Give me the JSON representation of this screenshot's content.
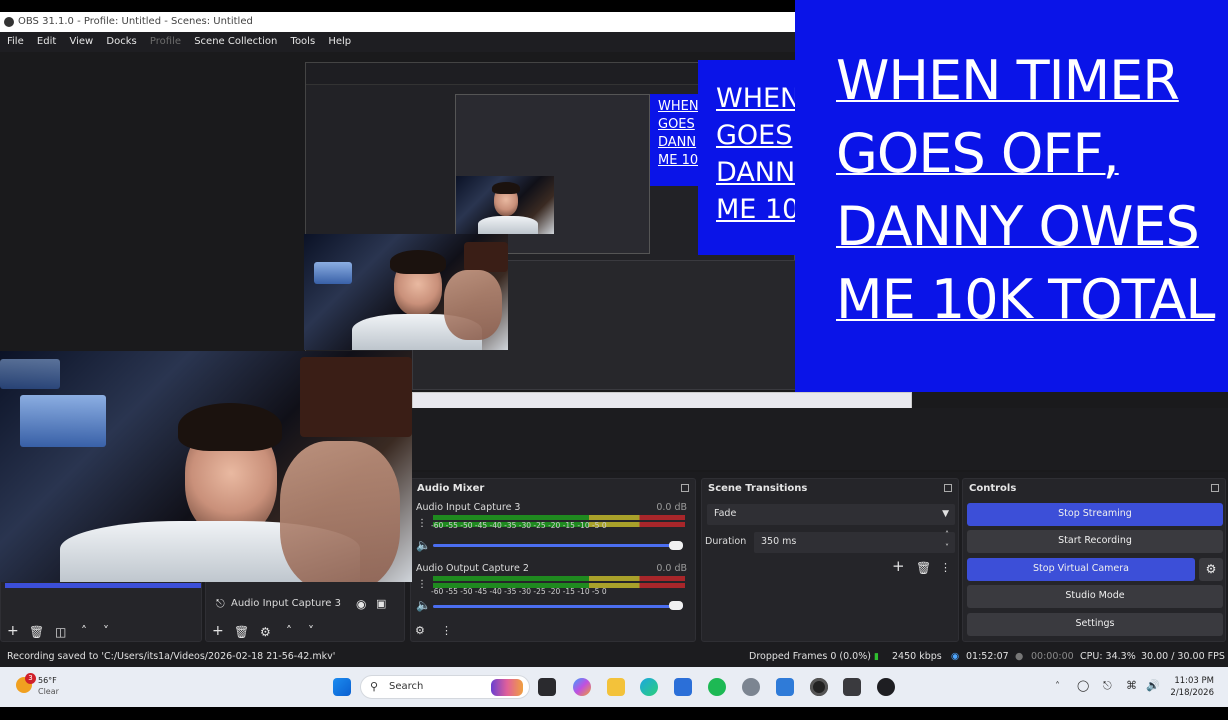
{
  "window": {
    "title": "OBS 31.1.0 - Profile: Untitled - Scenes: Untitled"
  },
  "menu": [
    "File",
    "Edit",
    "View",
    "Docks",
    "Profile",
    "Scene Collection",
    "Tools",
    "Help"
  ],
  "overlay": {
    "lines": [
      "WHEN TIMER",
      "GOES OFF,",
      "DANNY OWES",
      "ME 10K TOTAL"
    ],
    "nested_lines": [
      "WHEN",
      "GOES",
      "DANN",
      "ME 10"
    ],
    "nested_small_lines": [
      "WHEN",
      "GOES",
      "DANN",
      "ME 10"
    ],
    "bg_color": "#0a14e8"
  },
  "sources": {
    "item_label": "Audio Input Capture 3"
  },
  "audio_mixer": {
    "title": "Audio Mixer",
    "channels": [
      {
        "name": "Audio Input Capture 3",
        "db": "0.0 dB",
        "ticks": "-60  -55  -50  -45  -40  -35  -30  -25  -20  -15  -10   -5    0"
      },
      {
        "name": "Audio Output Capture 2",
        "db": "0.0 dB",
        "ticks": "-60  -55  -50  -45  -40  -35  -30  -25  -20  -15  -10   -5    0"
      }
    ]
  },
  "scene_transitions": {
    "title": "Scene Transitions",
    "transition": "Fade",
    "duration_label": "Duration",
    "duration_value": "350 ms"
  },
  "controls": {
    "title": "Controls",
    "stop_streaming": "Stop Streaming",
    "start_recording": "Start Recording",
    "stop_virtual_camera": "Stop Virtual Camera",
    "studio_mode": "Studio Mode",
    "settings": "Settings",
    "accent": "#3c4fd8"
  },
  "statusbar": {
    "message": "Recording saved to 'C:/Users/its1a/Videos/2026-02-18 21-56-42.mkv'",
    "dropped_frames": "Dropped Frames 0 (0.0%)",
    "bitrate": "2450 kbps",
    "stream_time": "01:52:07",
    "record_time": "00:00:00",
    "cpu": "CPU: 34.3%",
    "fps": "30.00 / 30.00 FPS"
  },
  "taskbar": {
    "weather_temp": "56°F",
    "weather_cond": "Clear",
    "weather_badge": "3",
    "search_placeholder": "Search",
    "time": "11:03 PM",
    "date": "2/18/2026"
  }
}
